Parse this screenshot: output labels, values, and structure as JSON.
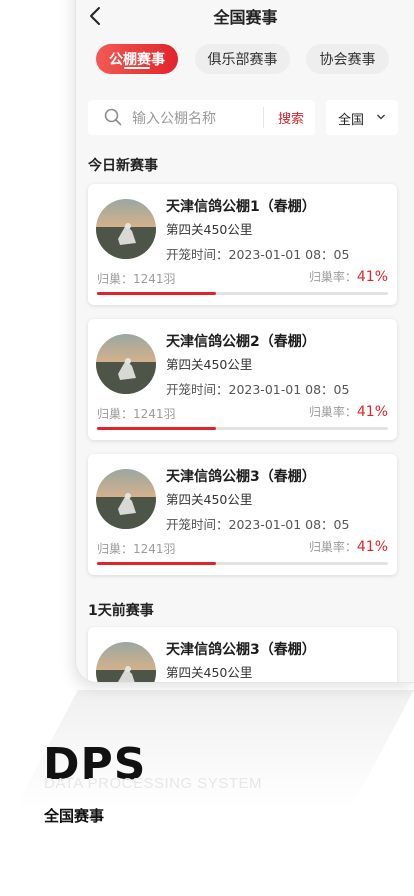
{
  "nav": {
    "title": "全国赛事"
  },
  "tabs": [
    {
      "label": "公棚赛事",
      "active": true
    },
    {
      "label": "俱乐部赛事",
      "active": false
    },
    {
      "label": "协会赛事",
      "active": false
    }
  ],
  "search": {
    "placeholder": "输入公棚名称",
    "button": "搜索",
    "region": "全国"
  },
  "sections": {
    "today": "今日新赛事",
    "yesterday": "1天前赛事"
  },
  "races": [
    {
      "name": "天津信鸽公棚1（春棚）",
      "stage": "第四关450公里",
      "time": "开笼时间：2023-01-01 08：05",
      "home": "归巢：1241羽",
      "rate_label": "归巢率：",
      "rate": "41%",
      "progress": 0.41
    },
    {
      "name": "天津信鸽公棚2（春棚）",
      "stage": "第四关450公里",
      "time": "开笼时间：2023-01-01 08：05",
      "home": "归巢：1241羽",
      "rate_label": "归巢率：",
      "rate": "41%",
      "progress": 0.41
    },
    {
      "name": "天津信鸽公棚3（春棚）",
      "stage": "第四关450公里",
      "time": "开笼时间：2023-01-01 08：05",
      "home": "归巢：1241羽",
      "rate_label": "归巢率：",
      "rate": "41%",
      "progress": 0.41
    },
    {
      "name": "天津信鸽公棚3（春棚）",
      "stage": "第四关450公里"
    }
  ],
  "brand": {
    "logo": "DPS",
    "subtitle": "DATA PROCESSING SYSTEM",
    "caption": "全国赛事"
  },
  "colors": {
    "accent": "#e2232b",
    "background": "#f7f7f7"
  }
}
